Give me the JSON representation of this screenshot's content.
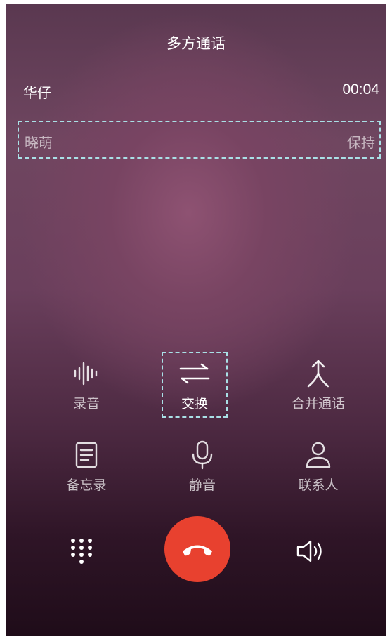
{
  "header": {
    "title": "多方通话"
  },
  "active_call": {
    "name": "华仔",
    "duration": "00:04"
  },
  "held_call": {
    "name": "晓萌",
    "status": "保持"
  },
  "controls": [
    {
      "id": "record",
      "label": "录音",
      "icon": "waveform-icon"
    },
    {
      "id": "swap",
      "label": "交换",
      "icon": "swap-arrows-icon"
    },
    {
      "id": "merge",
      "label": "合并通话",
      "icon": "merge-icon"
    },
    {
      "id": "notes",
      "label": "备忘录",
      "icon": "notepad-icon"
    },
    {
      "id": "mute",
      "label": "静音",
      "icon": "microphone-icon"
    },
    {
      "id": "contacts",
      "label": "联系人",
      "icon": "person-icon"
    }
  ],
  "bottom_bar": {
    "dialpad_icon": "dialpad-icon",
    "end_call_icon": "hang-up-icon",
    "end_call_color": "#e8412f",
    "speaker_icon": "speaker-icon"
  },
  "colors": {
    "highlight_outline": "#a9e0e6"
  }
}
